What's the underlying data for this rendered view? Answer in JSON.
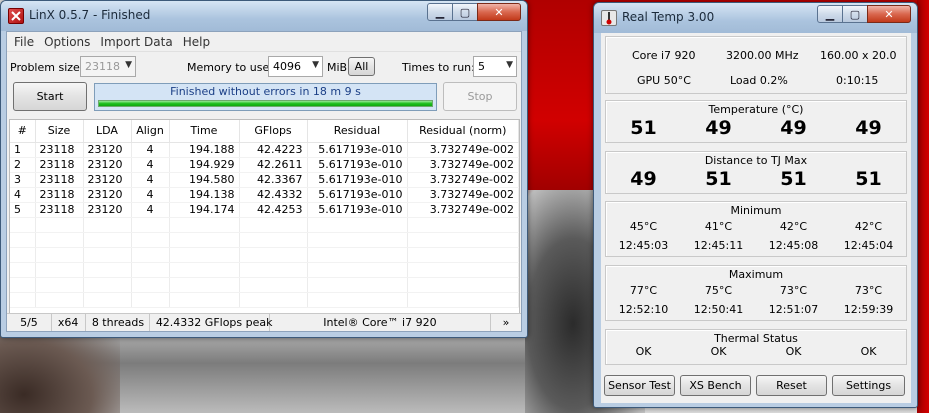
{
  "linx": {
    "title": "LinX 0.5.7 - Finished",
    "menu": [
      "File",
      "Options",
      "Import Data",
      "Help"
    ],
    "problem_size_label": "Problem size:",
    "problem_size_value": "23118",
    "memory_label": "Memory to use:",
    "memory_value": "4096",
    "memory_unit": "MiB",
    "all_label": "All",
    "times_label": "Times to run:",
    "times_value": "5",
    "start_label": "Start",
    "stop_label": "Stop",
    "status_message": "Finished without errors in 18 m 9 s",
    "progress_fraction": 1.0,
    "columns": [
      "#",
      "Size",
      "LDA",
      "Align",
      "Time",
      "GFlops",
      "Residual",
      "Residual (norm)"
    ],
    "rows": [
      [
        "1",
        "23118",
        "23120",
        "4",
        "194.188",
        "42.4223",
        "5.617193e-010",
        "3.732749e-002"
      ],
      [
        "2",
        "23118",
        "23120",
        "4",
        "194.929",
        "42.2611",
        "5.617193e-010",
        "3.732749e-002"
      ],
      [
        "3",
        "23118",
        "23120",
        "4",
        "194.580",
        "42.3367",
        "5.617193e-010",
        "3.732749e-002"
      ],
      [
        "4",
        "23118",
        "23120",
        "4",
        "194.138",
        "42.4332",
        "5.617193e-010",
        "3.732749e-002"
      ],
      [
        "5",
        "23118",
        "23120",
        "4",
        "194.174",
        "42.4253",
        "5.617193e-010",
        "3.732749e-002"
      ]
    ],
    "statusbar": {
      "runs": "5/5",
      "arch": "x64",
      "threads": "8 threads",
      "peak": "42.4332 GFlops peak",
      "cpu": "Intel® Core™ i7 920",
      "more": "»"
    }
  },
  "realtemp": {
    "title": "Real Temp 3.00",
    "cpu": "Core i7 920",
    "mhz": "3200.00 MHz",
    "multiplier": "160.00 x 20.0",
    "gpu": "GPU  50°C",
    "load": "Load  0.2%",
    "uptime": "0:10:15",
    "temperature_header": "Temperature (°C)",
    "temperatures": [
      "51",
      "49",
      "49",
      "49"
    ],
    "distance_header": "Distance to TJ Max",
    "distances": [
      "49",
      "51",
      "51",
      "51"
    ],
    "minimum_header": "Minimum",
    "minimum_temps": [
      "45°C",
      "41°C",
      "42°C",
      "42°C"
    ],
    "minimum_times": [
      "12:45:03",
      "12:45:11",
      "12:45:08",
      "12:45:04"
    ],
    "maximum_header": "Maximum",
    "maximum_temps": [
      "77°C",
      "75°C",
      "73°C",
      "73°C"
    ],
    "maximum_times": [
      "12:52:10",
      "12:50:41",
      "12:51:07",
      "12:59:39"
    ],
    "thermal_header": "Thermal Status",
    "thermal_status": [
      "OK",
      "OK",
      "OK",
      "OK"
    ],
    "buttons": {
      "sensor_test": "Sensor Test",
      "xs_bench": "XS Bench",
      "reset": "Reset",
      "settings": "Settings"
    }
  },
  "colors": {
    "progress_green": "#1fbf1f",
    "status_text": "#1b3f86",
    "close_red": "#c2391a"
  }
}
